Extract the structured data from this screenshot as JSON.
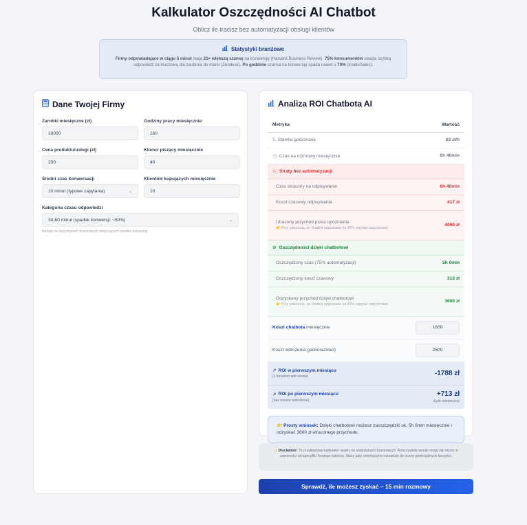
{
  "header": {
    "title": "Kalkulator Oszczędności AI Chatbot",
    "subtitle": "Oblicz ile tracisz bez automatyzacji obsługi klientów"
  },
  "stats": {
    "heading": "Statystyki branżowe",
    "p1_bold": "Firmy odpowiadające w ciągu 5 minut",
    "p1": " mają ",
    "p2_bold": "21× większą szansę",
    "p2": " na konwersję (Harvard Business Review). ",
    "p3_bold": "75% konsumentów",
    "p3": " uważa szybką odpowiedź za kluczową dla zaufania do marki (Zendesk). ",
    "p4_bold": "Po godzinie",
    "p4": " szansa na konwersję spada nawet o ",
    "p5_bold": "70%",
    "p5": " (InsideSales)."
  },
  "form": {
    "title": "Dane Twojej Firmy",
    "fields": [
      {
        "label": "Zarobki miesięczne (zł)",
        "value": "10000"
      },
      {
        "label": "Godziny pracy miesięcznie",
        "value": "160"
      },
      {
        "label": "Cena produktu/usługi (zł)",
        "value": "200"
      },
      {
        "label": "Klienci piszący miesięcznie",
        "value": "40"
      },
      {
        "label": "Średni czas konwersacji",
        "value": "10 minut (typowe zapytania)"
      },
      {
        "label": "Klientów kupujących miesięcznie",
        "value": "10"
      }
    ],
    "category_label": "Kategoria czasu odpowiedzi",
    "category_value": "30-60 minut (spadek konwersji: ~50%)",
    "category_hint": "Bazuje na statystykach branżowych dotyczących spadku konwersji"
  },
  "analysis": {
    "title": "Analiza ROI Chatbota AI",
    "col_metric": "Metryka",
    "col_value": "Wartość",
    "rate_label": "Stawka godzinowa",
    "rate_value": "63 zł/h",
    "time_label": "Czas na rozmowy miesięcznie",
    "time_value": "6h 40min",
    "loss_heading": "Straty bez automatyzacji",
    "loss_time_label": "Czas stracony na odpisywanie",
    "loss_time_value": "6h 40min",
    "loss_cost_label": "Koszt czasowy odpisywania",
    "loss_cost_value": "417 zł",
    "loss_rev_label": "Utracony przychód przez opóźnienia",
    "loss_rev_note": "Przy założeniu, że chatbot odpowiada na 90% zapytań natychmiast",
    "loss_rev_value": "4000 zł",
    "save_heading": "Oszczędności dzięki chatbotowi",
    "save_time_label": "Oszczędzony czas (75% automatyzacji)",
    "save_time_value": "5h 0min",
    "save_cost_label": "Oszczędzony koszt czasowy",
    "save_cost_value": "313 zł",
    "save_rev_label": "Odzyskany przychód dzięki chatbotowi",
    "save_rev_note": "Przy założeniu, że chatbot odpowiada na 90% zapytań natychmiast",
    "save_rev_value": "3600 zł",
    "chatbot_cost_label_a": "Koszt chatbota",
    "chatbot_cost_label_b": " miesięcznie",
    "chatbot_cost_value": "1600",
    "setup_cost_label": "Koszt wdrożenia (jednorazowo)",
    "setup_cost_value": "2500",
    "roi1_label": "ROI w pierwszym miesiącu",
    "roi1_sub": "(z kosztem wdrożenia)",
    "roi1_value": "-1788 zł",
    "roi2_label": "ROI po pierwszym miesiącu",
    "roi2_sub": "(bez kosztu wdrożenia)",
    "roi2_value": "+713 zł",
    "roi2_note": "Zysk miesięczny",
    "conclusion_bold": "Prosty wniosek:",
    "conclusion_text": " Dzięki chatbotowi możesz zaoszczędzić ok. 5h 0min miesięcznie i odzyskać 3600 zł utraconego przychodu."
  },
  "disclaimer": {
    "bold": "Disclaimer:",
    "text": " To przykładowy kalkulator oparty na statystykach branżowych. Rzeczywiste wyniki mogą się różnić w zależności od specyfiki Twojego biznesu. Służy jako orientacyjne narzędzie do oceny potencjalnych korzyści."
  },
  "cta_label": "Sprawdź, ile możesz zyskać – 15 min rozmowy",
  "icons": [
    "chart-icon",
    "calculator-icon",
    "dollar-icon",
    "clock-icon",
    "warning-icon",
    "check-circle-icon",
    "trending-up-icon",
    "hand-icon"
  ],
  "colors": {
    "primary": "#1e40af",
    "loss": "#dc2626",
    "gain": "#15803d"
  }
}
